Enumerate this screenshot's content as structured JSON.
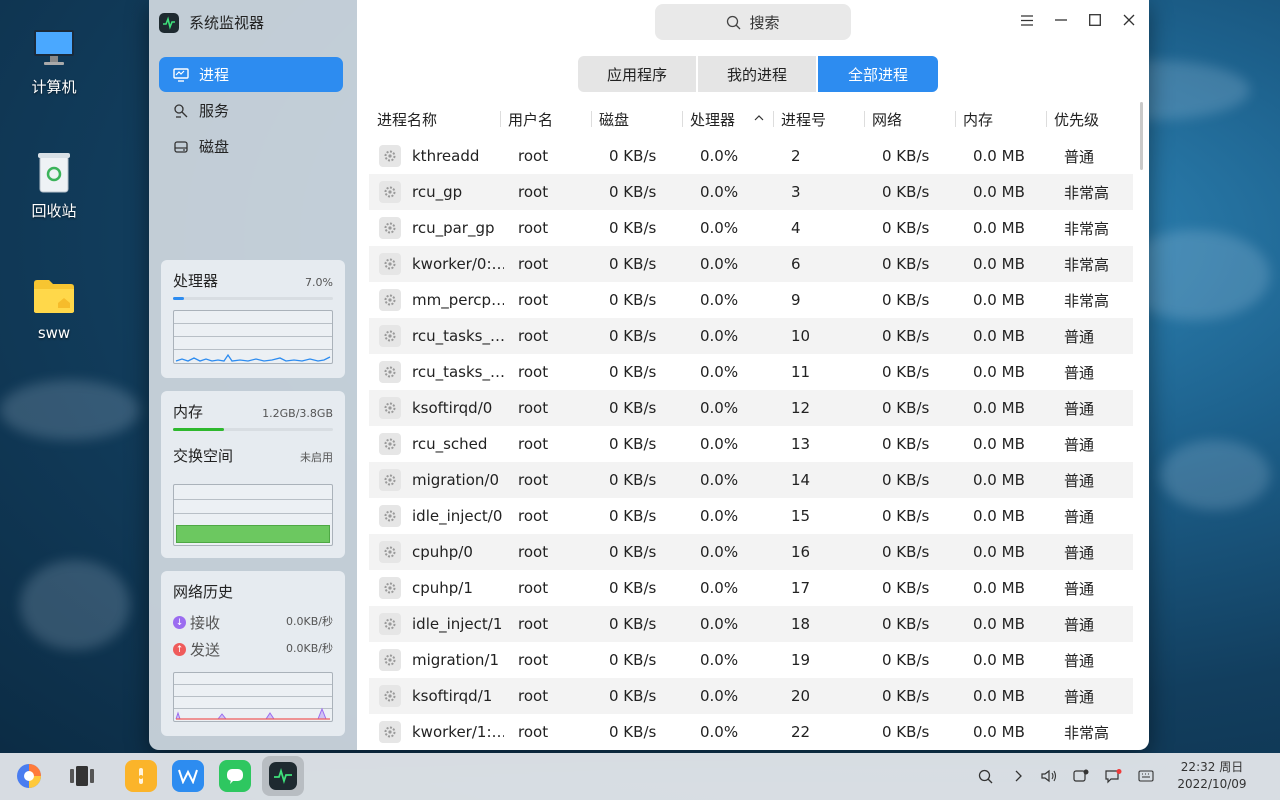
{
  "desktop": {
    "icons": [
      {
        "label": "计算机",
        "icon": "computer-icon"
      },
      {
        "label": "回收站",
        "icon": "trash-icon"
      },
      {
        "label": "sww",
        "icon": "folder-icon"
      }
    ]
  },
  "app": {
    "title": "系统监视器",
    "nav": [
      {
        "label": "进程",
        "icon": "monitor-icon",
        "active": true
      },
      {
        "label": "服务",
        "icon": "service-icon",
        "active": false
      },
      {
        "label": "磁盘",
        "icon": "disk-icon",
        "active": false
      }
    ],
    "cpu": {
      "label": "处理器",
      "value": "7.0%",
      "fraction": 0.07
    },
    "memory": {
      "label": "内存",
      "value": "1.2GB/3.8GB",
      "fraction": 0.316
    },
    "swap": {
      "label": "交换空间",
      "value": "未启用"
    },
    "network": {
      "label": "网络历史",
      "receive_label": "接收",
      "receive_value": "0.0KB/秒",
      "send_label": "发送",
      "send_value": "0.0KB/秒"
    }
  },
  "search": {
    "label": "搜索"
  },
  "tabs": [
    "应用程序",
    "我的进程",
    "全部进程"
  ],
  "active_tab": 2,
  "columns": [
    "进程名称",
    "用户名",
    "磁盘",
    "处理器",
    "进程号",
    "网络",
    "内存",
    "优先级"
  ],
  "sort_column": "处理器",
  "processes": [
    {
      "name": "kthreadd",
      "user": "root",
      "disk": "0 KB/s",
      "cpu": "0.0%",
      "pid": "2",
      "net": "0 KB/s",
      "mem": "0.0 MB",
      "prio": "普通"
    },
    {
      "name": "rcu_gp",
      "user": "root",
      "disk": "0 KB/s",
      "cpu": "0.0%",
      "pid": "3",
      "net": "0 KB/s",
      "mem": "0.0 MB",
      "prio": "非常高"
    },
    {
      "name": "rcu_par_gp",
      "user": "root",
      "disk": "0 KB/s",
      "cpu": "0.0%",
      "pid": "4",
      "net": "0 KB/s",
      "mem": "0.0 MB",
      "prio": "非常高"
    },
    {
      "name": "kworker/0:…",
      "user": "root",
      "disk": "0 KB/s",
      "cpu": "0.0%",
      "pid": "6",
      "net": "0 KB/s",
      "mem": "0.0 MB",
      "prio": "非常高"
    },
    {
      "name": "mm_percp…",
      "user": "root",
      "disk": "0 KB/s",
      "cpu": "0.0%",
      "pid": "9",
      "net": "0 KB/s",
      "mem": "0.0 MB",
      "prio": "非常高"
    },
    {
      "name": "rcu_tasks_…",
      "user": "root",
      "disk": "0 KB/s",
      "cpu": "0.0%",
      "pid": "10",
      "net": "0 KB/s",
      "mem": "0.0 MB",
      "prio": "普通"
    },
    {
      "name": "rcu_tasks_…",
      "user": "root",
      "disk": "0 KB/s",
      "cpu": "0.0%",
      "pid": "11",
      "net": "0 KB/s",
      "mem": "0.0 MB",
      "prio": "普通"
    },
    {
      "name": "ksoftirqd/0",
      "user": "root",
      "disk": "0 KB/s",
      "cpu": "0.0%",
      "pid": "12",
      "net": "0 KB/s",
      "mem": "0.0 MB",
      "prio": "普通"
    },
    {
      "name": "rcu_sched",
      "user": "root",
      "disk": "0 KB/s",
      "cpu": "0.0%",
      "pid": "13",
      "net": "0 KB/s",
      "mem": "0.0 MB",
      "prio": "普通"
    },
    {
      "name": "migration/0",
      "user": "root",
      "disk": "0 KB/s",
      "cpu": "0.0%",
      "pid": "14",
      "net": "0 KB/s",
      "mem": "0.0 MB",
      "prio": "普通"
    },
    {
      "name": "idle_inject/0",
      "user": "root",
      "disk": "0 KB/s",
      "cpu": "0.0%",
      "pid": "15",
      "net": "0 KB/s",
      "mem": "0.0 MB",
      "prio": "普通"
    },
    {
      "name": "cpuhp/0",
      "user": "root",
      "disk": "0 KB/s",
      "cpu": "0.0%",
      "pid": "16",
      "net": "0 KB/s",
      "mem": "0.0 MB",
      "prio": "普通"
    },
    {
      "name": "cpuhp/1",
      "user": "root",
      "disk": "0 KB/s",
      "cpu": "0.0%",
      "pid": "17",
      "net": "0 KB/s",
      "mem": "0.0 MB",
      "prio": "普通"
    },
    {
      "name": "idle_inject/1",
      "user": "root",
      "disk": "0 KB/s",
      "cpu": "0.0%",
      "pid": "18",
      "net": "0 KB/s",
      "mem": "0.0 MB",
      "prio": "普通"
    },
    {
      "name": "migration/1",
      "user": "root",
      "disk": "0 KB/s",
      "cpu": "0.0%",
      "pid": "19",
      "net": "0 KB/s",
      "mem": "0.0 MB",
      "prio": "普通"
    },
    {
      "name": "ksoftirqd/1",
      "user": "root",
      "disk": "0 KB/s",
      "cpu": "0.0%",
      "pid": "20",
      "net": "0 KB/s",
      "mem": "0.0 MB",
      "prio": "普通"
    },
    {
      "name": "kworker/1:…",
      "user": "root",
      "disk": "0 KB/s",
      "cpu": "0.0%",
      "pid": "22",
      "net": "0 KB/s",
      "mem": "0.0 MB",
      "prio": "非常高"
    }
  ],
  "taskbar": {
    "apps": [
      "browser-icon",
      "multitask-view-icon",
      "file-manager-icon",
      "wps-icon",
      "wechat-icon",
      "system-monitor-icon"
    ],
    "tray": [
      "search-icon",
      "chevron-right-icon",
      "volume-icon",
      "notification-icon",
      "message-icon",
      "keyboard-icon"
    ],
    "time": "22:32 周日",
    "date": "2022/10/09"
  },
  "colors": {
    "accent": "#2d8cf0",
    "memory_bar": "#2eb82e",
    "swap_fill": "#6cc860",
    "receive": "#9b6cf0",
    "send": "#ef5b5b"
  }
}
